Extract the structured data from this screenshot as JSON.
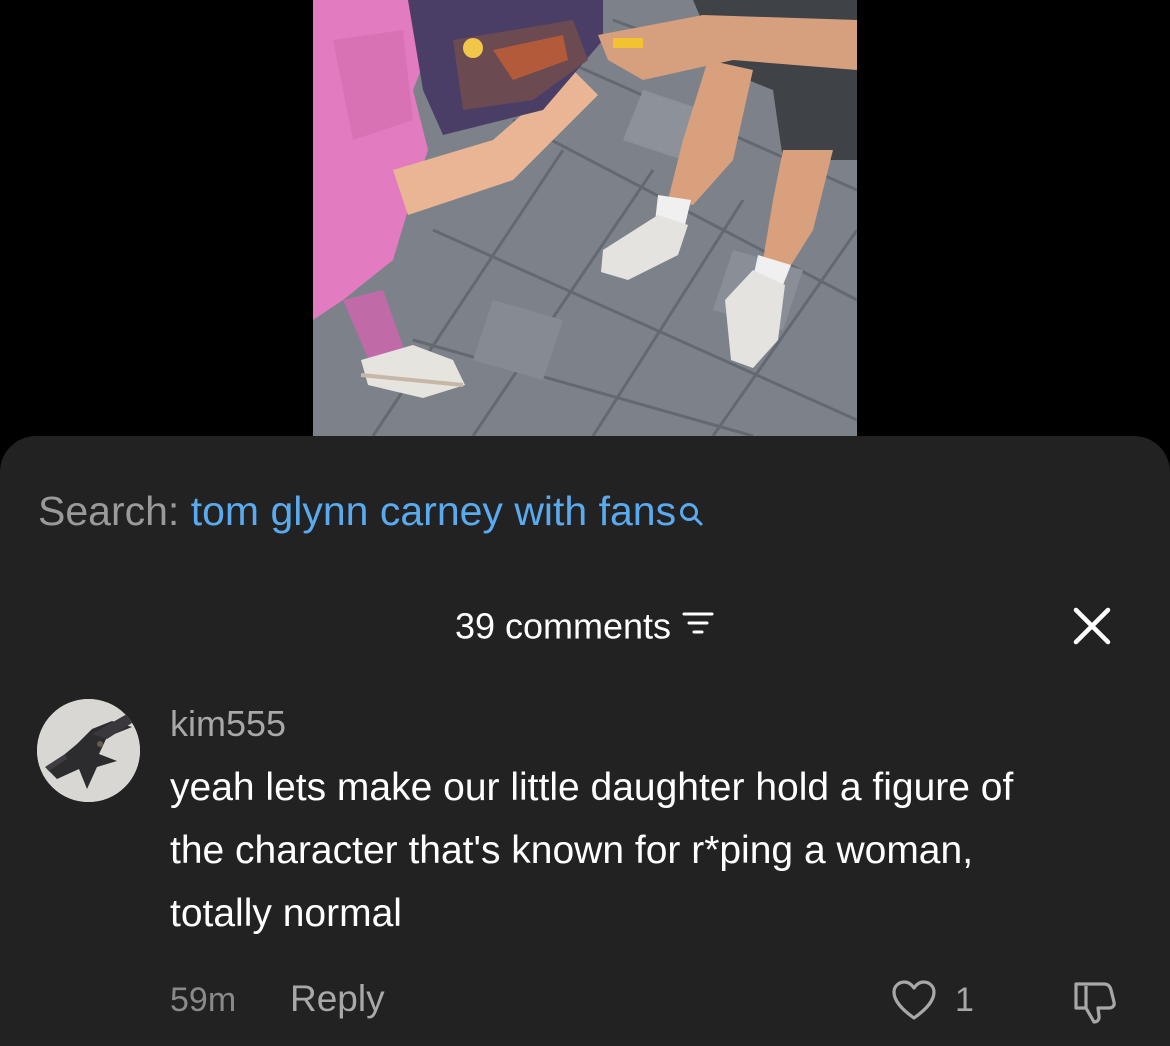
{
  "video": {
    "description_icon": "video-frame-photo"
  },
  "search": {
    "prefix": "Search:",
    "query": "tom glynn carney with fans"
  },
  "comments": {
    "header": "39 comments"
  },
  "comment": {
    "username": "kim555",
    "text": "yeah lets make our little daughter hold a figure of the character that's known for r*ping a woman, totally normal",
    "time": "59m",
    "reply_label": "Reply",
    "like_count": "1"
  },
  "colors": {
    "sheet_bg": "#222222",
    "search_link": "#5aaaf0",
    "secondary_text": "#a8a8a8",
    "primary_text": "#ffffff"
  },
  "icons": {
    "search": "search-icon",
    "filter": "filter-icon",
    "close": "close-icon",
    "like": "heart-icon",
    "dislike": "thumbs-down-icon"
  }
}
